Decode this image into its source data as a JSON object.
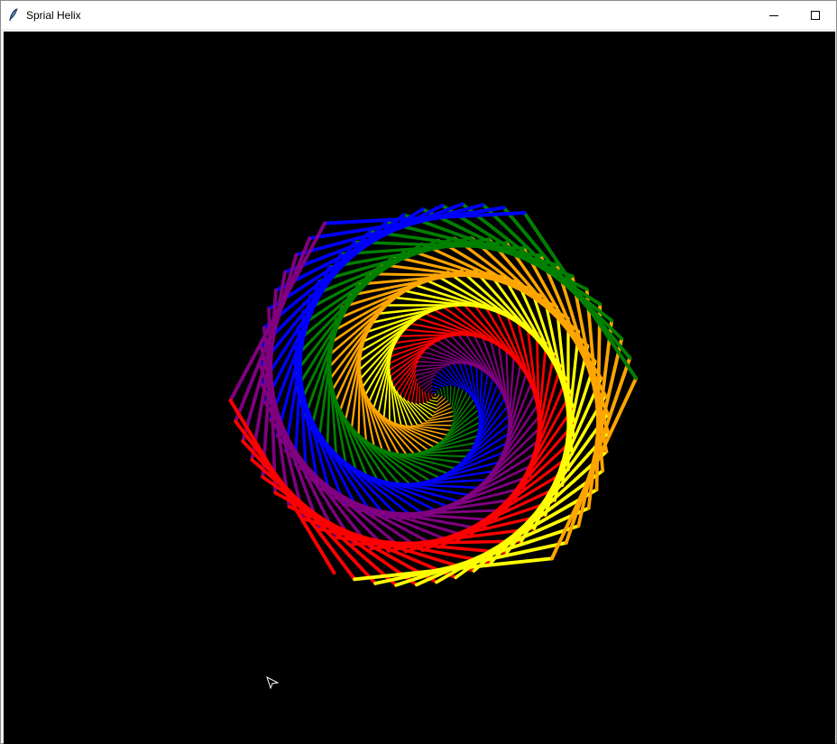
{
  "window": {
    "title": "Sprial Helix",
    "icon": "feather-icon",
    "controls": {
      "minimize": "minimize-icon",
      "maximize": "maximize-icon"
    }
  },
  "canvas": {
    "background": "#000000",
    "cursor_icon": "turtle-arrow-icon"
  },
  "drawing": {
    "colors": [
      "yellow",
      "orange",
      "green",
      "blue",
      "purple",
      "red"
    ]
  }
}
